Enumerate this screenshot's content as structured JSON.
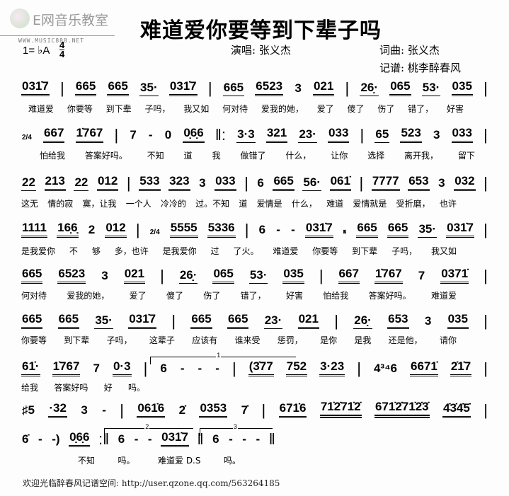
{
  "header": {
    "logo_text": "E网音乐教室",
    "site_url": "WWW.MUSIC888.NET",
    "title": "难道爱你要等到下辈子吗",
    "key": "1= ♭A",
    "time_signature": [
      "4",
      "4"
    ],
    "singer": "演唱: 张义杰",
    "composer": "词曲: 张义杰",
    "transcriber": "记谱: 桃李醉春风"
  },
  "lines": [
    {
      "notes": [
        {
          "t": "031̇7",
          "u": 2
        },
        "|",
        {
          "t": "665",
          "u": 2
        },
        {
          "t": "665",
          "u": 2
        },
        {
          "t": "35·",
          "u": 1
        },
        {
          "t": "031̇7",
          "u": 2
        },
        "|",
        {
          "t": "665",
          "u": 1
        },
        {
          "t": "6523",
          "u": 2
        },
        {
          "t": "3"
        },
        {
          "t": "021",
          "u": 2
        },
        "|",
        {
          "t": "26̣·",
          "u": 1
        },
        {
          "t": "065",
          "u": 2
        },
        {
          "t": "53·",
          "u": 1
        },
        {
          "t": "035",
          "u": 2
        },
        "|"
      ],
      "lyrics": [
        "难道爱",
        "你要等",
        "到下辈",
        "子吗，",
        "我又如",
        "何对待",
        "爱我的她，",
        "爱了",
        "傻了",
        "伤了",
        "错了，",
        "好害"
      ]
    },
    {
      "notes": [
        {
          "t": "2/4",
          "small": true
        },
        {
          "t": "667",
          "u": 2
        },
        {
          "t": "1̇767",
          "u": 2
        },
        "|",
        {
          "t": "7"
        },
        {
          "t": "-"
        },
        {
          "t": "0"
        },
        {
          "t": "0̣6̣6",
          "u": 2
        },
        "‖:",
        {
          "t": "3·3",
          "u": 1
        },
        {
          "t": "321",
          "u": 2
        },
        {
          "t": "23·",
          "u": 1
        },
        {
          "t": "033",
          "u": 2
        },
        "|",
        {
          "t": "65",
          "u": 1
        },
        {
          "t": "523",
          "u": 2
        },
        {
          "t": "3"
        },
        {
          "t": "033",
          "u": 2
        },
        "|"
      ],
      "lyrics": [
        "怕给我",
        "答案好吗。",
        "不知",
        "道",
        "我",
        "做错了",
        "什么，",
        "让你",
        "选择",
        "离开我，",
        "留下"
      ]
    },
    {
      "notes": [
        {
          "t": "22",
          "u": 1
        },
        {
          "t": "213",
          "u": 2
        },
        {
          "t": "22",
          "u": 1
        },
        {
          "t": "012",
          "u": 2
        },
        "|",
        {
          "t": "533",
          "u": 2
        },
        {
          "t": "323",
          "u": 2
        },
        {
          "t": "3"
        },
        {
          "t": "033",
          "u": 2
        },
        "|",
        {
          "t": "6"
        },
        {
          "t": "665",
          "u": 2
        },
        {
          "t": "56·",
          "u": 1
        },
        {
          "t": "061̇",
          "u": 2
        },
        "|",
        {
          "t": "7777",
          "u": 2
        },
        {
          "t": "653",
          "u": 2
        },
        {
          "t": "3"
        },
        {
          "t": "032",
          "u": 2
        },
        "|"
      ],
      "lyrics": [
        "这无",
        "情的寂",
        "寞，让我",
        "一个人",
        "冷冷的",
        "过。不知",
        "道",
        "爱情是",
        "什么，",
        "难道",
        "爱情就是",
        "受折磨，",
        "也许"
      ]
    },
    {
      "notes": [
        {
          "t": "1111",
          "u": 2
        },
        {
          "t": "16̣6̣",
          "u": 2
        },
        {
          "t": "2"
        },
        {
          "t": "012",
          "u": 2
        },
        "|",
        {
          "t": "2/4",
          "small": true
        },
        {
          "t": "5555",
          "u": 2
        },
        {
          "t": "5336",
          "u": 2
        },
        "|",
        {
          "t": "6"
        },
        {
          "t": "-"
        },
        {
          "t": "-"
        },
        {
          "t": "031̇7",
          "u": 2
        },
        {
          "t": "𝄋",
          "small": true
        },
        {
          "t": "665",
          "u": 2
        },
        {
          "t": "665",
          "u": 2
        },
        {
          "t": "35·",
          "u": 1
        },
        {
          "t": "031̇7",
          "u": 2
        },
        "|"
      ],
      "lyrics": [
        "是我爱你",
        "不",
        "够",
        "多，也许",
        "是我爱你",
        "过",
        "了火。",
        "难道爱",
        "你要等",
        "到下辈",
        "子吗，",
        "我又如"
      ]
    },
    {
      "notes": [
        {
          "t": "665",
          "u": 2
        },
        {
          "t": "6523",
          "u": 2
        },
        {
          "t": "3"
        },
        {
          "t": "021",
          "u": 2
        },
        "|",
        {
          "t": "26̣·",
          "u": 1
        },
        {
          "t": "065",
          "u": 2
        },
        {
          "t": "53·",
          "u": 1
        },
        {
          "t": "035",
          "u": 2
        },
        "|",
        {
          "t": "667",
          "u": 2
        },
        {
          "t": "1̇767",
          "u": 2
        },
        {
          "t": "7"
        },
        {
          "t": "0371̇",
          "u": 2
        },
        "|"
      ],
      "lyrics": [
        "何对待",
        "爱我的她，",
        "爱了",
        "傻了",
        "伤了",
        "错了，",
        "好害",
        "怕给我",
        "答案好吗。",
        "难道爱"
      ]
    },
    {
      "notes": [
        {
          "t": "665",
          "u": 2
        },
        {
          "t": "665",
          "u": 2
        },
        {
          "t": "35·",
          "u": 1
        },
        {
          "t": "031̇7",
          "u": 2
        },
        "|",
        {
          "t": "665",
          "u": 2
        },
        {
          "t": "665",
          "u": 2
        },
        {
          "t": "23·",
          "u": 1
        },
        {
          "t": "021",
          "u": 2
        },
        "|",
        {
          "t": "26̣·",
          "u": 1
        },
        {
          "t": "653",
          "u": 2
        },
        {
          "t": "3"
        },
        {
          "t": "035",
          "u": 2
        },
        "|"
      ],
      "lyrics": [
        "你要等",
        "到下辈",
        "子吗，",
        "这辈子",
        "应该有",
        "谁来受",
        "惩罚，",
        "是你",
        "是我",
        "还是他，",
        "请你"
      ]
    },
    {
      "notes": [
        {
          "t": "61̇·",
          "u": 2
        },
        {
          "t": "1̇767",
          "u": 2
        },
        {
          "t": "7"
        },
        {
          "t": "0·3",
          "u": 2
        },
        "|",
        {
          "t": "6"
        },
        {
          "t": "-"
        },
        {
          "t": "-"
        },
        {
          "t": "-"
        },
        "|",
        {
          "t": "(3̇77",
          "u": 2
        },
        {
          "t": "752",
          "u": 2
        },
        {
          "t": "3·23",
          "u": 2
        },
        "|",
        {
          "t": "4³⁴6"
        },
        {
          "t": "6671̇",
          "u": 2
        },
        {
          "t": "2̇1̇7",
          "u": 2
        },
        "|"
      ],
      "lyrics": [
        "给我",
        "答案好吗",
        "好",
        "吗。"
      ]
    },
    {
      "notes": [
        {
          "t": "♯5"
        },
        {
          "t": "·32",
          "u": 2
        },
        {
          "t": "3"
        },
        {
          "t": "-"
        },
        "|",
        {
          "t": "061̇6",
          "u": 2
        },
        {
          "t": "2̇"
        },
        {
          "t": "0353",
          "u": 2
        },
        {
          "t": "7̇"
        },
        "|",
        {
          "t": "671̇6",
          "u": 2
        },
        {
          "t": "71̇2̇71̇2̇",
          "u": 3
        },
        {
          "t": "671̇2̇71̇2̇3̇",
          "u": 3
        },
        {
          "t": "4̇3̇4̇5̇",
          "u": 2
        },
        "|"
      ],
      "lyrics": []
    },
    {
      "notes": [
        {
          "t": "6̇"
        },
        {
          "t": "-"
        },
        {
          "t": "-)"
        },
        {
          "t": "0̣6̣6",
          "u": 2
        },
        ":‖",
        {
          "t": "6"
        },
        {
          "t": "-"
        },
        {
          "t": "-"
        },
        {
          "t": "031̇7",
          "u": 2
        },
        "‖",
        {
          "t": "6"
        },
        {
          "t": "-"
        },
        {
          "t": "-"
        },
        {
          "t": "-"
        },
        "‖"
      ],
      "lyrics": [
        "不知",
        "吗。",
        "难道爱 D.S",
        "吗。"
      ]
    }
  ],
  "voltas": [
    "1",
    "2",
    "3"
  ],
  "footer": "欢迎光临醉春风记谱空间: http://user.qzone.qq.com/563264185"
}
